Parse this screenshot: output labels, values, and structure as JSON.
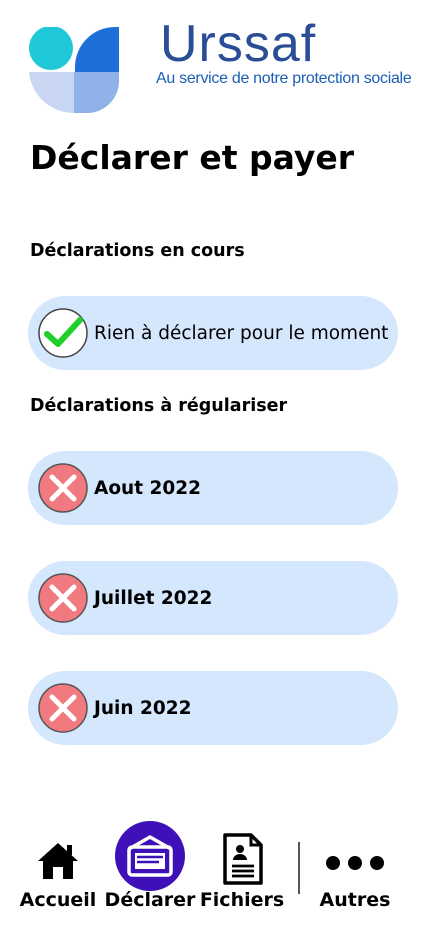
{
  "header": {
    "brand_name": "Urssaf",
    "brand_tagline": "Au service de notre protection sociale",
    "colors": {
      "brand_blue": "#2a4e96",
      "tagline_blue": "#1a5fb4",
      "logo_cyan": "#1ec8d8",
      "logo_blue": "#1f6fd8",
      "logo_light": "#c9d7f2",
      "logo_mid": "#8fb3e8"
    }
  },
  "page": {
    "title": "Déclarer et payer"
  },
  "sections": {
    "current": {
      "title": "Déclarations en cours",
      "items": [
        {
          "label": "Rien à déclarer pour le moment",
          "status_icon": "check-icon"
        }
      ]
    },
    "to_regularize": {
      "title": "Déclarations à régulariser",
      "items": [
        {
          "label": "Aout 2022",
          "status_icon": "error-x-icon"
        },
        {
          "label": "Juillet 2022",
          "status_icon": "error-x-icon"
        },
        {
          "label": "Juin 2022",
          "status_icon": "error-x-icon"
        }
      ]
    }
  },
  "bottom_nav": {
    "items": [
      {
        "label": "Accueil",
        "icon": "home-icon"
      },
      {
        "label": "Déclarer",
        "icon": "declare-envelope-icon",
        "active": true
      },
      {
        "label": "Fichiers",
        "icon": "document-icon"
      },
      {
        "label": "Autres",
        "icon": "more-dots-icon"
      }
    ],
    "active_color": "#3d10b8"
  },
  "colors": {
    "card_bg": "#d4e7fd",
    "check_green": "#1fcf2a",
    "error_red": "#f07a80"
  }
}
